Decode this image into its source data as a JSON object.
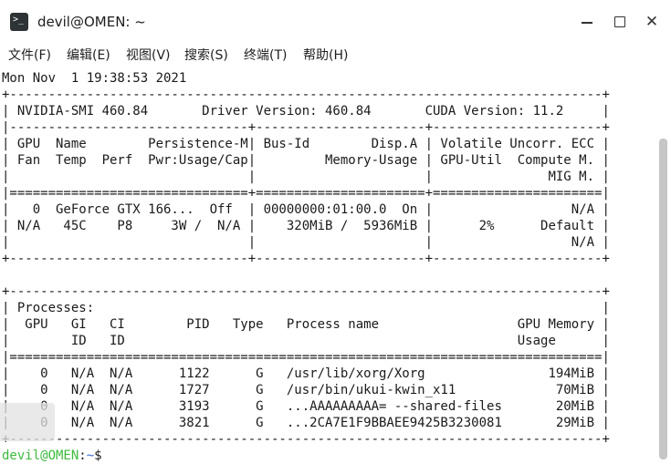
{
  "window": {
    "title": "devil@OMEN: ~",
    "icon": "terminal-icon"
  },
  "menu": [
    {
      "label": "文件(F)"
    },
    {
      "label": "编辑(E)"
    },
    {
      "label": "视图(V)"
    },
    {
      "label": "搜索(S)"
    },
    {
      "label": "终端(T)"
    },
    {
      "label": "帮助(H)"
    }
  ],
  "terminal": {
    "lines": [
      "Mon Nov  1 19:38:53 2021",
      "+-----------------------------------------------------------------------------+",
      "| NVIDIA-SMI 460.84       Driver Version: 460.84       CUDA Version: 11.2     |",
      "|-------------------------------+----------------------+----------------------+",
      "| GPU  Name        Persistence-M| Bus-Id        Disp.A | Volatile Uncorr. ECC |",
      "| Fan  Temp  Perf  Pwr:Usage/Cap|         Memory-Usage | GPU-Util  Compute M. |",
      "|                               |                      |               MIG M. |",
      "|===============================+======================+======================|",
      "|   0  GeForce GTX 166...  Off  | 00000000:01:00.0  On |                  N/A |",
      "| N/A   45C    P8     3W /  N/A |    320MiB /  5936MiB |      2%      Default |",
      "|                               |                      |                  N/A |",
      "+-------------------------------+----------------------+----------------------+",
      "",
      "+-----------------------------------------------------------------------------+",
      "| Processes:                                                                  |",
      "|  GPU   GI   CI        PID   Type   Process name                  GPU Memory |",
      "|        ID   ID                                                   Usage      |",
      "|=============================================================================|",
      "|    0   N/A  N/A      1122      G   /usr/lib/xorg/Xorg                194MiB |",
      "|    0   N/A  N/A      1727      G   /usr/bin/ukui-kwin_x11             70MiB |",
      "|    0   N/A  N/A      3193      G   ...AAAAAAAAA= --shared-files       20MiB |",
      "|    0   N/A  N/A      3821      G   ...2CA7E1F9BBAEE9425B3230081       29MiB |",
      "+-----------------------------------------------------------------------------+"
    ],
    "prompt": {
      "user_host": "devil@OMEN",
      "separator": ":",
      "path": "~",
      "symbol": "$"
    }
  },
  "colors": {
    "prompt_user": "#3dbb3d",
    "prompt_path": "#3b6bd6",
    "background": "#ffffff",
    "text": "#1a1a1a"
  }
}
